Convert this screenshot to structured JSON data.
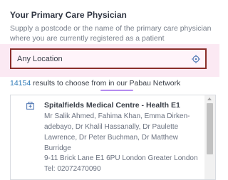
{
  "section": {
    "title": "Your Primary Care Physician",
    "subtitle": "Supply a postcode or the name of the primary care physician where you are currently registered as a patient"
  },
  "search": {
    "value": "Any Location",
    "placeholder": "Any Location",
    "icon": "location-target-icon",
    "border_color": "#8a2e2a"
  },
  "results": {
    "count": "14154",
    "suffix": "results to choose from in our Pabau Network"
  },
  "practices": [
    {
      "name": "Spitalfields Medical Centre - Health E1",
      "doctors": "Mr Salik Ahmed, Fahima Khan, Emma Dirken-adebayo, Dr Khalil Hassanally, Dr Paulette Lawrence, Dr Peter Buchman, Dr Matthew Burridge",
      "address": "9-11 Brick Lane E1 6PU London Greater London",
      "tel": "Tel: 02072470090",
      "icon": "hospital-building-icon"
    }
  ],
  "colors": {
    "accent_blue": "#2e7ab8",
    "highlight_pink": "#fbe9f3",
    "underline_purple": "#b58cf0"
  }
}
